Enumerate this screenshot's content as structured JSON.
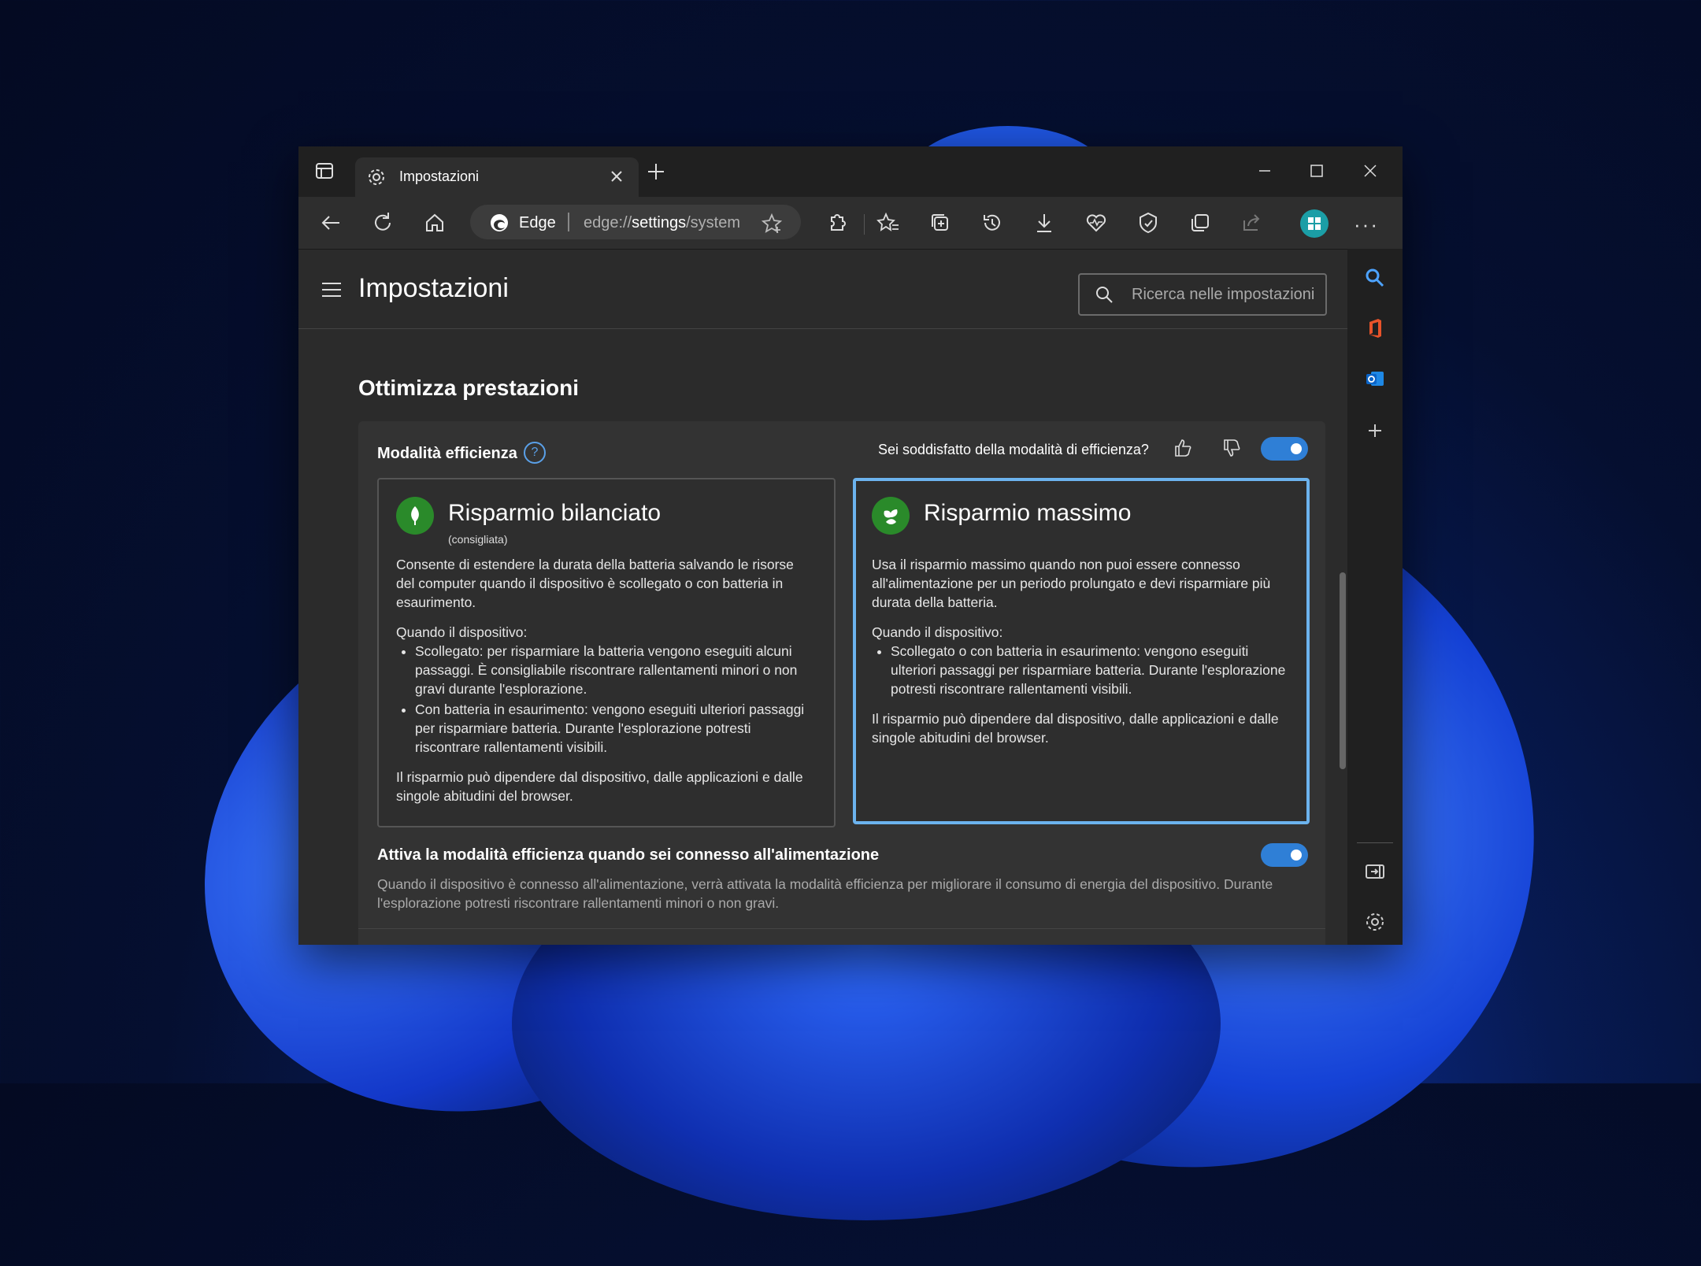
{
  "tab": {
    "title": "Impostazioni"
  },
  "address": {
    "brand": "Edge",
    "url_prefix": "edge://",
    "url_main": "settings",
    "url_suffix": "/system"
  },
  "header": {
    "title": "Impostazioni",
    "search_placeholder": "Ricerca nelle impostazioni"
  },
  "section": {
    "title": "Ottimizza prestazioni"
  },
  "efficiency": {
    "label": "Modalità efficienza",
    "help": "?",
    "feedback_question": "Sei soddisfatto della modalità di efficienza?",
    "toggle_on": true
  },
  "options": {
    "balanced": {
      "title": "Risparmio bilanciato",
      "subtitle": "(consigliata)",
      "description": "Consente di estendere la durata della batteria salvando le risorse del computer quando il dispositivo è scollegato o con batteria in esaurimento.",
      "when": "Quando il dispositivo:",
      "bullets": [
        "Scollegato: per risparmiare la batteria vengono eseguiti alcuni passaggi. È consigliabile riscontrare rallentamenti minori o non gravi durante l'esplorazione.",
        "Con batteria in esaurimento: vengono eseguiti ulteriori passaggi per risparmiare batteria. Durante l'esplorazione potresti riscontrare rallentamenti visibili."
      ],
      "note": "Il risparmio può dipendere dal dispositivo, dalle applicazioni e dalle singole abitudini del browser."
    },
    "maximum": {
      "title": "Risparmio massimo",
      "description": "Usa il risparmio massimo quando non puoi essere connesso all'alimentazione per un periodo prolungato e devi risparmiare più durata della batteria.",
      "when": "Quando il dispositivo:",
      "bullets": [
        "Scollegato o con batteria in esaurimento: vengono eseguiti ulteriori passaggi per risparmiare batteria. Durante l'esplorazione potresti riscontrare rallentamenti visibili."
      ],
      "note": "Il risparmio può dipendere dal dispositivo, dalle applicazioni e dalle singole abitudini del browser.",
      "selected": true
    }
  },
  "plugged": {
    "title": "Attiva la modalità efficienza quando sei connesso all'alimentazione",
    "description": "Quando il dispositivo è connesso all'alimentazione, verrà attivata la modalità efficienza per migliorare il consumo di energia del dispositivo. Durante l'esplorazione potresti riscontrare rallentamenti minori o non gravi.",
    "toggle_on": true
  },
  "colors": {
    "accent": "#2f7fd6",
    "selected_border": "#6cb3ee",
    "leaf_green": "#2a8a2a"
  }
}
